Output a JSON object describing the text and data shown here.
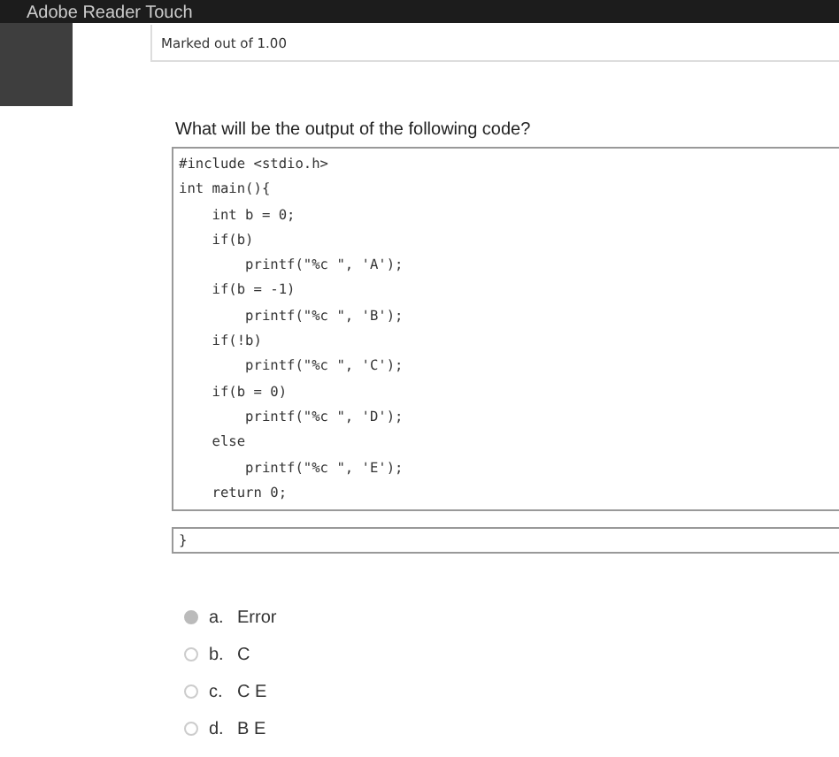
{
  "window": {
    "title": "Adobe Reader Touch"
  },
  "grade": "Marked out of 1.00",
  "question": "What will be the output of the following code?",
  "code": "#include <stdio.h>\nint main(){\n    int b = 0;\n    if(b)\n        printf(\"%c \", 'A');\n    if(b = -1)\n        printf(\"%c \", 'B');\n    if(!b)\n        printf(\"%c \", 'C');\n    if(b = 0)\n        printf(\"%c \", 'D');\n    else\n        printf(\"%c \", 'E');\n    return 0;",
  "code_tail": "}",
  "options": [
    {
      "letter": "a.",
      "text": "Error",
      "selected": true
    },
    {
      "letter": "b.",
      "text": "C",
      "selected": false
    },
    {
      "letter": "c.",
      "text": "C E",
      "selected": false
    },
    {
      "letter": "d.",
      "text": "B E",
      "selected": false
    }
  ]
}
